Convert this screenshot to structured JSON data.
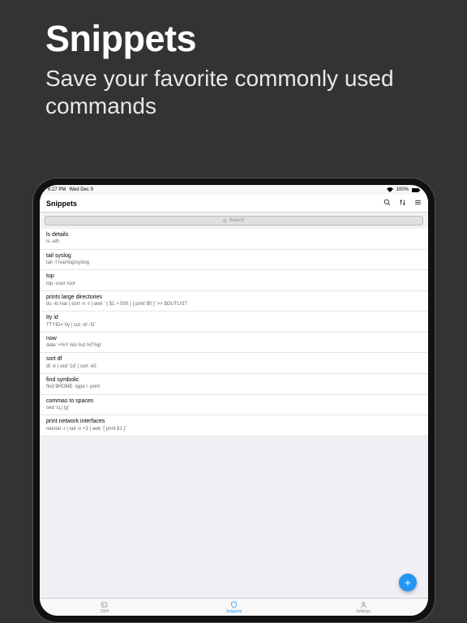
{
  "promo": {
    "title": "Snippets",
    "subtitle": "Save your favorite commonly used commands"
  },
  "statusbar": {
    "time": "6:27 PM",
    "date": "Wed Dec 9",
    "battery": "100%"
  },
  "navbar": {
    "title": "Snippets"
  },
  "search": {
    "placeholder": "Search"
  },
  "snippets": [
    {
      "title": "ls details",
      "cmd": "ls -alh"
    },
    {
      "title": "tail syslog",
      "cmd": "tail -f /var/log/syslog"
    },
    {
      "title": "top",
      "cmd": "top -user root"
    },
    {
      "title": "prints large directories",
      "cmd": "du -kl /var | sort -n -r | awk ' { $1 > 500 } { print $0 }' >> $OUTLIST"
    },
    {
      "title": "tty id",
      "cmd": "TTYID=`tty | cut -d/ -f3`"
    },
    {
      "title": "now",
      "cmd": "date '+%Y %b %d %T%p'"
    },
    {
      "title": "sort df",
      "cmd": "df -k | sed '1d' | sort -k5"
    },
    {
      "title": "find symbolic",
      "cmd": "find $HOME -type l -print"
    },
    {
      "title": "commas to spaces",
      "cmd": "sed 's|,| |g'"
    },
    {
      "title": "print network interfaces",
      "cmd": "netstat -r | tail -n +3 | awk '{ print $1 }'"
    }
  ],
  "fab": {
    "label": "+"
  },
  "tabs": [
    {
      "label": "SSH",
      "active": false
    },
    {
      "label": "Snippets",
      "active": true
    },
    {
      "label": "Settings",
      "active": false
    }
  ]
}
